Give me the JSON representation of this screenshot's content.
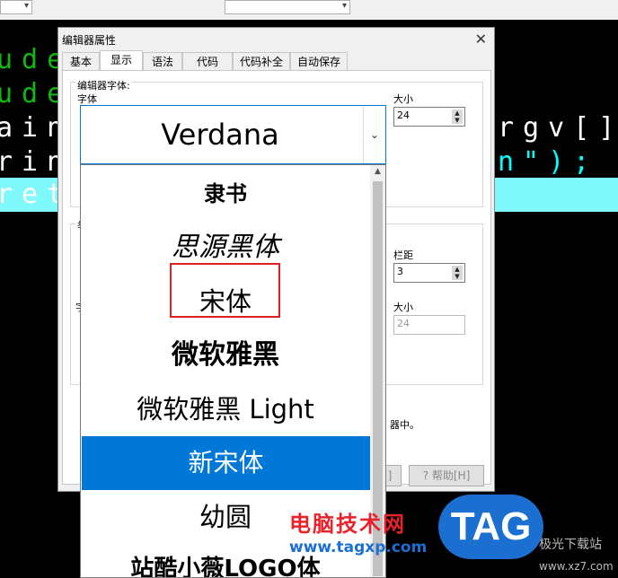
{
  "code_lines": [
    {
      "text": "ude",
      "color": "#11b711"
    },
    {
      "text": "ude",
      "color": "#11b711"
    },
    {
      "text": "ain",
      "color": "#ffffff"
    },
    {
      "text": "rin",
      "color": "#ffffff"
    },
    {
      "text": "ret",
      "color": "#ffffff"
    }
  ],
  "code_right": [
    {
      "text": "rgv[]",
      "color_main": "#ffffff"
    },
    {
      "text": "n\");",
      "color_main": "#00ffff"
    }
  ],
  "dialog": {
    "title": "编辑器属性",
    "close_icon": "close-icon",
    "tabs": [
      {
        "label": "基本",
        "active": false
      },
      {
        "label": "显示",
        "active": true
      },
      {
        "label": "语法",
        "active": false
      },
      {
        "label": "代码",
        "active": false
      },
      {
        "label": "代码补全",
        "active": false
      },
      {
        "label": "自动保存",
        "active": false
      }
    ],
    "editor_font_group": "编辑器字体:",
    "font_label": "字体",
    "size_label": "大小",
    "size_value": "24",
    "gutter_label": "栏距",
    "gutter_value": "3",
    "size2_label": "大小",
    "size2_value": "24",
    "group2_label": "举",
    "side_label": "字",
    "note_suffix": "器中。",
    "ok_suffix": "]",
    "help_button": "帮助[H]"
  },
  "font_combo": {
    "value": "Verdana",
    "dropdown_icon": "chevron-down-icon"
  },
  "font_list": {
    "items": [
      {
        "label": "隶书",
        "selected": false
      },
      {
        "label": "思源黑体",
        "selected": false
      },
      {
        "label": "宋体",
        "selected": false
      },
      {
        "label": "微软雅黑",
        "selected": false
      },
      {
        "label": "微软雅黑 Light",
        "selected": false
      },
      {
        "label": "新宋体",
        "selected": true
      },
      {
        "label": "幼圆",
        "selected": false
      },
      {
        "label": "站酷小薇LOGO体",
        "selected": false
      }
    ],
    "highlight_color": "#0078d7",
    "annotation_color": "#e02020"
  },
  "watermark": {
    "brand": "电脑技术网",
    "url": "www.tagxp.com",
    "logo": "TAG",
    "right1": "极光下载站",
    "right2": "www.xz7.com"
  }
}
